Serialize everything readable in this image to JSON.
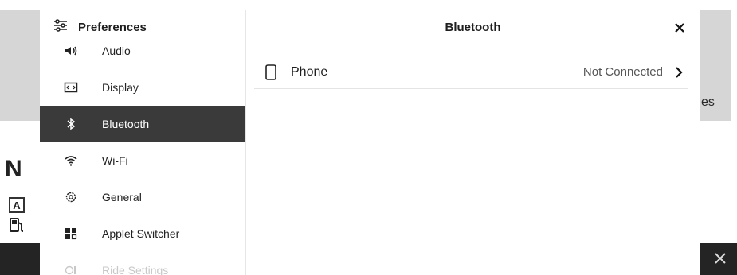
{
  "background": {
    "partial_text": "es",
    "gear_letter": "N",
    "auto_badge": "A"
  },
  "sidebar": {
    "title": "Preferences",
    "title_icon": "sliders-icon",
    "items": [
      {
        "label": "Audio",
        "icon": "speaker-icon"
      },
      {
        "label": "Display",
        "icon": "display-icon"
      },
      {
        "label": "Bluetooth",
        "icon": "bluetooth-icon",
        "active": true
      },
      {
        "label": "Wi-Fi",
        "icon": "wifi-icon"
      },
      {
        "label": "General",
        "icon": "gear-icon"
      },
      {
        "label": "Applet Switcher",
        "icon": "grid-icon"
      },
      {
        "label": "Ride Settings",
        "icon": "ride-settings-icon"
      }
    ]
  },
  "content": {
    "title": "Bluetooth",
    "rows": [
      {
        "label": "Phone",
        "status": "Not Connected",
        "icon": "phone-icon"
      }
    ]
  },
  "colors": {
    "active_bg": "#3a3a3a",
    "dim_bg": "#d6d6d6",
    "bottom_bar": "#242424"
  }
}
